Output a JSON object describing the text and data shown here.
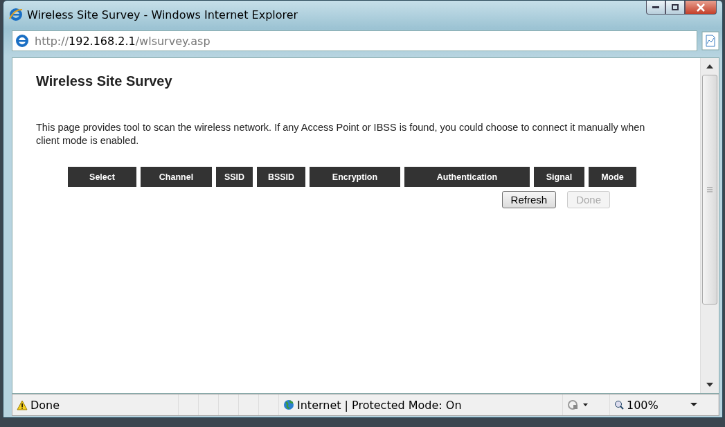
{
  "window": {
    "title": "Wireless Site Survey - Windows Internet Explorer"
  },
  "address_bar": {
    "scheme": "http://",
    "host": "192.168.2.1",
    "path": "/wlsurvey.asp"
  },
  "page": {
    "heading": "Wireless Site Survey",
    "description": "This page provides tool to scan the wireless network. If any Access Point or IBSS is found, you could choose to connect it manually when client mode is enabled.",
    "table": {
      "columns": [
        "Select",
        "Channel",
        "SSID",
        "BSSID",
        "Encryption",
        "Authentication",
        "Signal",
        "Mode"
      ]
    },
    "buttons": [
      {
        "label": "Refresh",
        "disabled": false
      },
      {
        "label": "Done",
        "disabled": true
      }
    ]
  },
  "status_bar": {
    "status": "Done",
    "zone": "Internet | Protected Mode: On",
    "zoom": "100%"
  }
}
